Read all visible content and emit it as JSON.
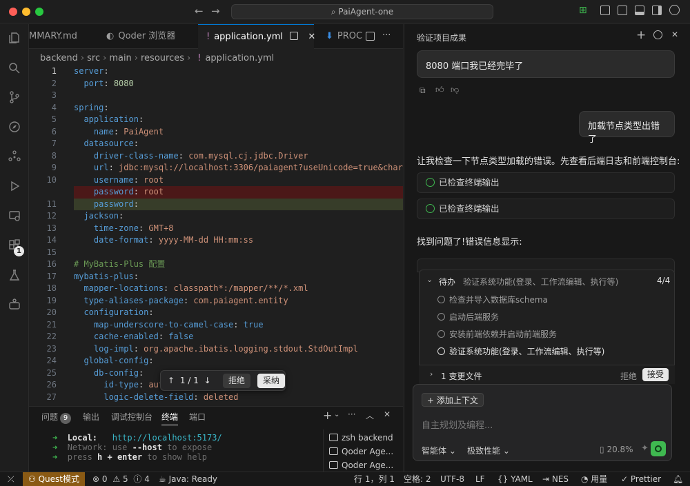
{
  "window": {
    "title": "PaiAgent-one"
  },
  "tabs": [
    {
      "label": "MMARY.md"
    },
    {
      "label": "Qoder 浏览器"
    },
    {
      "label": "application.yml"
    },
    {
      "label": "PROC"
    }
  ],
  "breadcrumb": [
    "backend",
    "src",
    "main",
    "resources",
    "application.yml"
  ],
  "code": {
    "lines": [
      {
        "n": "1",
        "text": "server:"
      },
      {
        "n": "2",
        "text": "  port: 8080"
      },
      {
        "n": "3",
        "text": ""
      },
      {
        "n": "4",
        "text": "spring:"
      },
      {
        "n": "5",
        "text": "  application:"
      },
      {
        "n": "6",
        "text": "    name: PaiAgent"
      },
      {
        "n": "7",
        "text": "  datasource:"
      },
      {
        "n": "8",
        "text": "    driver-class-name: com.mysql.cj.jdbc.Driver"
      },
      {
        "n": "9",
        "text": "    url: jdbc:mysql://localhost:3306/paiagent?useUnicode=true&charac"
      },
      {
        "n": "10",
        "text": "    username: root"
      },
      {
        "n": "",
        "text": "    password: root"
      },
      {
        "n": "11",
        "text": "    password:"
      },
      {
        "n": "12",
        "text": "  jackson:"
      },
      {
        "n": "13",
        "text": "    time-zone: GMT+8"
      },
      {
        "n": "14",
        "text": "    date-format: yyyy-MM-dd HH:mm:ss"
      },
      {
        "n": "15",
        "text": ""
      },
      {
        "n": "16",
        "text": "# MyBatis-Plus 配置"
      },
      {
        "n": "17",
        "text": "mybatis-plus:"
      },
      {
        "n": "18",
        "text": "  mapper-locations: classpath*:/mapper/**/*.xml"
      },
      {
        "n": "19",
        "text": "  type-aliases-package: com.paiagent.entity"
      },
      {
        "n": "20",
        "text": "  configuration:"
      },
      {
        "n": "21",
        "text": "    map-underscore-to-camel-case: true"
      },
      {
        "n": "22",
        "text": "    cache-enabled: false"
      },
      {
        "n": "23",
        "text": "    log-impl: org.apache.ibatis.logging.stdout.StdOutImpl"
      },
      {
        "n": "24",
        "text": "  global-config:"
      },
      {
        "n": "25",
        "text": "    db-config:"
      },
      {
        "n": "26",
        "text": "      id-type: aut"
      },
      {
        "n": "27",
        "text": "      logic-delete-field: deleted"
      }
    ]
  },
  "inline_diff": {
    "counter": "1 / 1",
    "reject": "拒绝",
    "accept": "采纳"
  },
  "panel": {
    "tabs": [
      "问题",
      "输出",
      "调试控制台",
      "终端",
      "端口"
    ],
    "problems_count": "9",
    "terminal_lines": [
      {
        "label": "Local:",
        "rest": "http://localhost:5173/"
      },
      {
        "label": "Network:",
        "rest": "use --host to expose"
      },
      {
        "label": "press",
        "rest": "h + enter to show help"
      }
    ],
    "terminals": [
      "zsh backend",
      "Qoder Age...",
      "Qoder Age..."
    ]
  },
  "agent": {
    "title": "验证项目成果",
    "msg1": "8080 端口我已经完毕了",
    "msg2": "加载节点类型出错了",
    "reply1": "让我检查一下节点类型加载的错误。先查看后端日志和前端控制台:",
    "check1": "已检查终端输出",
    "check2": "已检查终端输出",
    "reply2": "找到问题了!错误信息显示:",
    "todo": {
      "header_label": "待办",
      "header_task": "验证系统功能(登录、工作流编辑、执行等)",
      "progress": "4/4",
      "items": [
        "检查并导入数据库schema",
        "启动后端服务",
        "安装前端依赖并启动前端服务",
        "验证系统功能(登录、工作流编辑、执行等)"
      ]
    },
    "files_changed": "1 变更文件",
    "files_reject": "拒绝",
    "files_accept": "接受",
    "add_context": "添加上下文",
    "input_placeholder": "自主规划及编程...",
    "mode": "智能体",
    "performance": "极致性能",
    "context_usage": "20.8%"
  },
  "statusbar": {
    "quest_mode": "Quest模式",
    "errors": "0",
    "warnings": "5",
    "info": "4",
    "java": "Java: Ready",
    "position": "行 1，列 1",
    "spaces": "空格: 2",
    "encoding": "UTF-8",
    "eol": "LF",
    "language": "YAML",
    "nes": "NES",
    "usage": "用量",
    "prettier": "Prettier"
  },
  "colors": {
    "accent": "#0078d4",
    "success": "#3fb950",
    "quest": "#8a5a14"
  }
}
